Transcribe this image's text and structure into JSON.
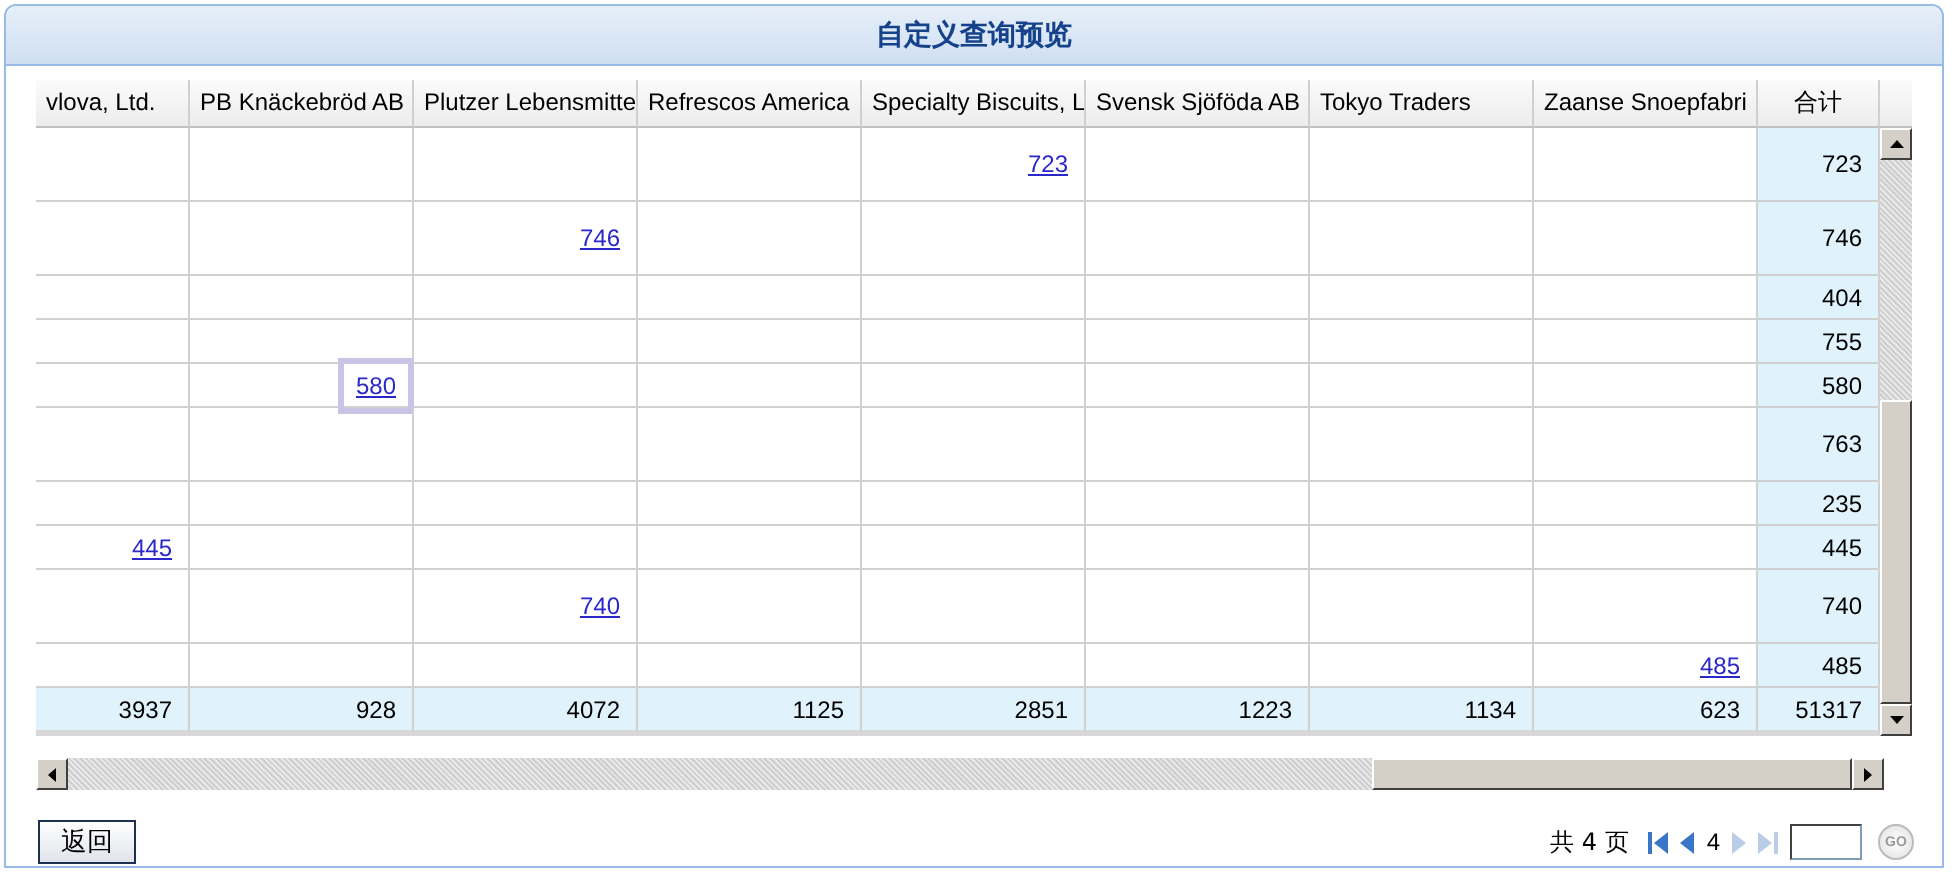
{
  "window": {
    "title": "自定义查询预览"
  },
  "table": {
    "columns": [
      "vlova, Ltd.",
      "PB Knäckebröd AB",
      "Plutzer Lebensmitte",
      "Refrescos America",
      "Specialty Biscuits, L",
      "Svensk Sjöföda AB",
      "Tokyo Traders",
      "Zaanse Snoepfabri",
      "合计"
    ],
    "rows": [
      {
        "kind": "tall",
        "cells": [
          null,
          null,
          null,
          null,
          {
            "text": "723",
            "selected": false
          },
          null,
          null,
          null
        ],
        "total": "723"
      },
      {
        "kind": "tall",
        "cells": [
          null,
          null,
          {
            "text": "746",
            "selected": false
          },
          null,
          null,
          null,
          null,
          null
        ],
        "total": "746"
      },
      {
        "kind": "short",
        "cells": [
          null,
          null,
          null,
          null,
          null,
          null,
          null,
          null
        ],
        "total": "404"
      },
      {
        "kind": "short",
        "cells": [
          null,
          null,
          null,
          null,
          null,
          null,
          null,
          null
        ],
        "total": "755"
      },
      {
        "kind": "short",
        "cells": [
          null,
          {
            "text": "580",
            "selected": true
          },
          null,
          null,
          null,
          null,
          null,
          null
        ],
        "total": "580"
      },
      {
        "kind": "tall",
        "cells": [
          null,
          null,
          null,
          null,
          null,
          null,
          null,
          null
        ],
        "total": "763"
      },
      {
        "kind": "short",
        "cells": [
          null,
          null,
          null,
          null,
          null,
          null,
          null,
          null
        ],
        "total": "235"
      },
      {
        "kind": "short",
        "cells": [
          {
            "text": "445",
            "selected": false
          },
          null,
          null,
          null,
          null,
          null,
          null,
          null
        ],
        "total": "445"
      },
      {
        "kind": "tall",
        "cells": [
          null,
          null,
          {
            "text": "740",
            "selected": false
          },
          null,
          null,
          null,
          null,
          null
        ],
        "total": "740"
      },
      {
        "kind": "short",
        "cells": [
          null,
          null,
          null,
          null,
          null,
          null,
          null,
          {
            "text": "485",
            "selected": false
          }
        ],
        "total": "485"
      }
    ],
    "totals": [
      "3937",
      "928",
      "4072",
      "1125",
      "2851",
      "1223",
      "1134",
      "623",
      "51317"
    ]
  },
  "buttons": [
    "返回"
  ],
  "pager": {
    "summary": "共 4 页",
    "current": "4",
    "first_disabled": false,
    "prev_disabled": false,
    "next_disabled": true,
    "last_disabled": true,
    "go": "GO"
  }
}
